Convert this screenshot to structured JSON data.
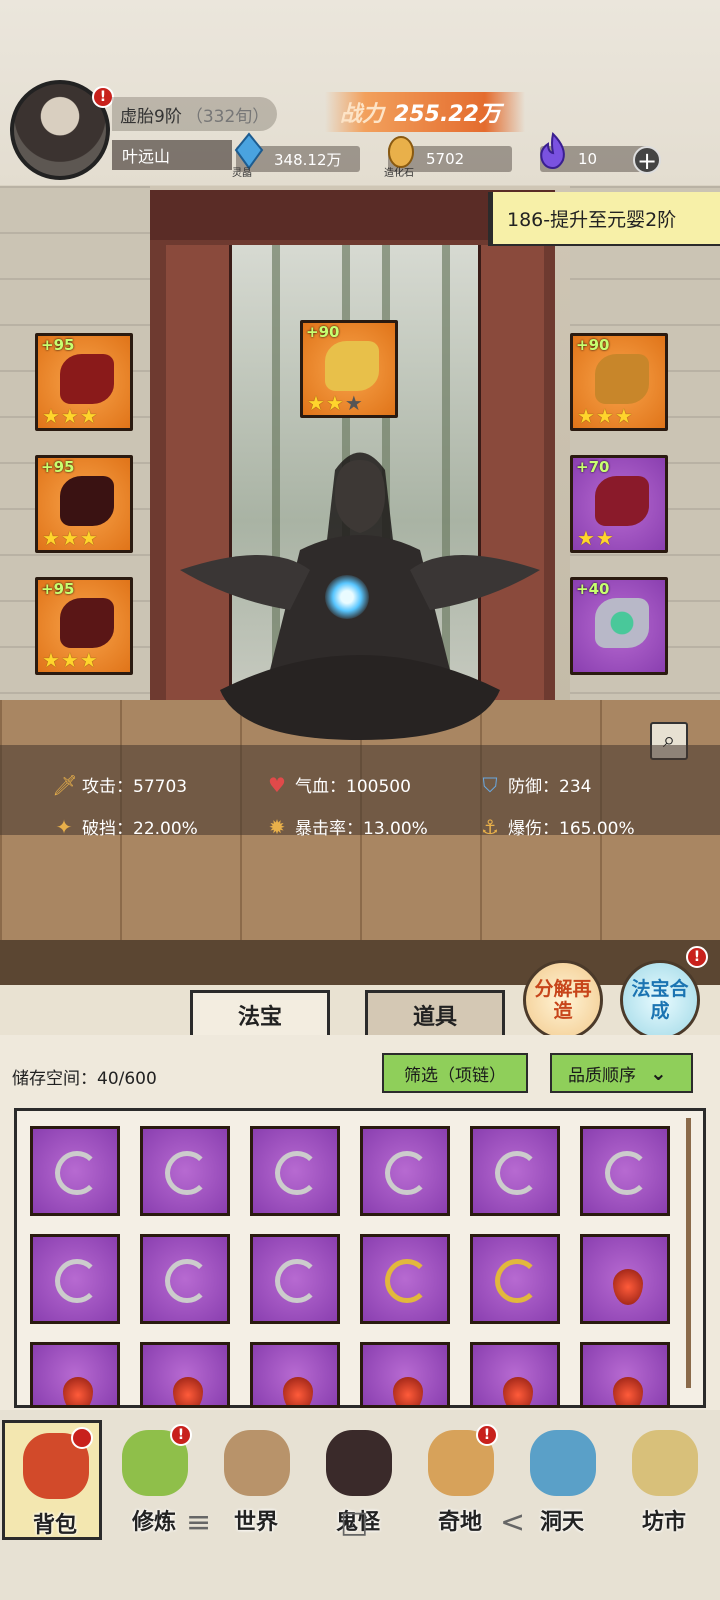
{
  "player": {
    "stage": "虚胎9阶",
    "stage_count": "（332旬）",
    "name": "叶远山",
    "power_label": "战力",
    "power_value": "255.22万"
  },
  "resources": [
    {
      "name": "灵晶",
      "value": "348.12万",
      "icon": "crystal-icon",
      "color": "#4aa3e0"
    },
    {
      "name": "造化石",
      "value": "5702",
      "icon": "stone-icon",
      "color": "#e9b04a"
    },
    {
      "name": "",
      "value": "10",
      "icon": "flame-icon",
      "color": "#7a52e0"
    }
  ],
  "quest": "186-提升至元婴2阶",
  "equipment": [
    {
      "slot": "weapon",
      "level": "+95",
      "stars": 3,
      "max": 3,
      "quality": "orange"
    },
    {
      "slot": "armor",
      "level": "+95",
      "stars": 3,
      "max": 3,
      "quality": "orange"
    },
    {
      "slot": "boots",
      "level": "+95",
      "stars": 3,
      "max": 3,
      "quality": "orange"
    },
    {
      "slot": "artifact",
      "level": "+90",
      "stars": 2,
      "max": 3,
      "quality": "orange"
    },
    {
      "slot": "crown",
      "level": "+90",
      "stars": 3,
      "max": 3,
      "quality": "orange"
    },
    {
      "slot": "necklace",
      "level": "+70",
      "stars": 2,
      "max": 2,
      "quality": "purple"
    },
    {
      "slot": "ring",
      "level": "+40",
      "stars": 0,
      "max": 0,
      "quality": "purple"
    }
  ],
  "stats": {
    "attack": "攻击：57703",
    "hp": "气血：100500",
    "defense": "防御：234",
    "pierce": "破挡：22.00%",
    "crit_rate": "暴击率：13.00%",
    "crit_dmg": "爆伤：165.00%"
  },
  "side_buttons": {
    "decompose": "分解再造",
    "synthesize": "法宝合成"
  },
  "tabs": {
    "fabao": "法宝",
    "daoju": "道具"
  },
  "inventory": {
    "storage_label": "储存空间：40/600",
    "filter": "筛选（项链）",
    "sort": "品质顺序",
    "items": [
      "silver",
      "silver",
      "silver",
      "silver",
      "silver",
      "silver",
      "silver",
      "silver",
      "silver",
      "gold",
      "gold",
      "red",
      "red",
      "red",
      "red",
      "red",
      "red",
      "red"
    ]
  },
  "nav": [
    {
      "label": "背包",
      "color": "#d24a2a",
      "badge": true
    },
    {
      "label": "修炼",
      "color": "#8fbf4a",
      "badge": true
    },
    {
      "label": "世界",
      "color": "#b8936a",
      "badge": false
    },
    {
      "label": "鬼怪",
      "color": "#3a2a2a",
      "badge": false
    },
    {
      "label": "奇地",
      "color": "#d7a25a",
      "badge": true
    },
    {
      "label": "洞天",
      "color": "#5aa0c8",
      "badge": false
    },
    {
      "label": "坊市",
      "color": "#d8c07a",
      "badge": false
    }
  ],
  "system_bar": {
    "menu": "≡",
    "home": "□",
    "back": "<"
  }
}
